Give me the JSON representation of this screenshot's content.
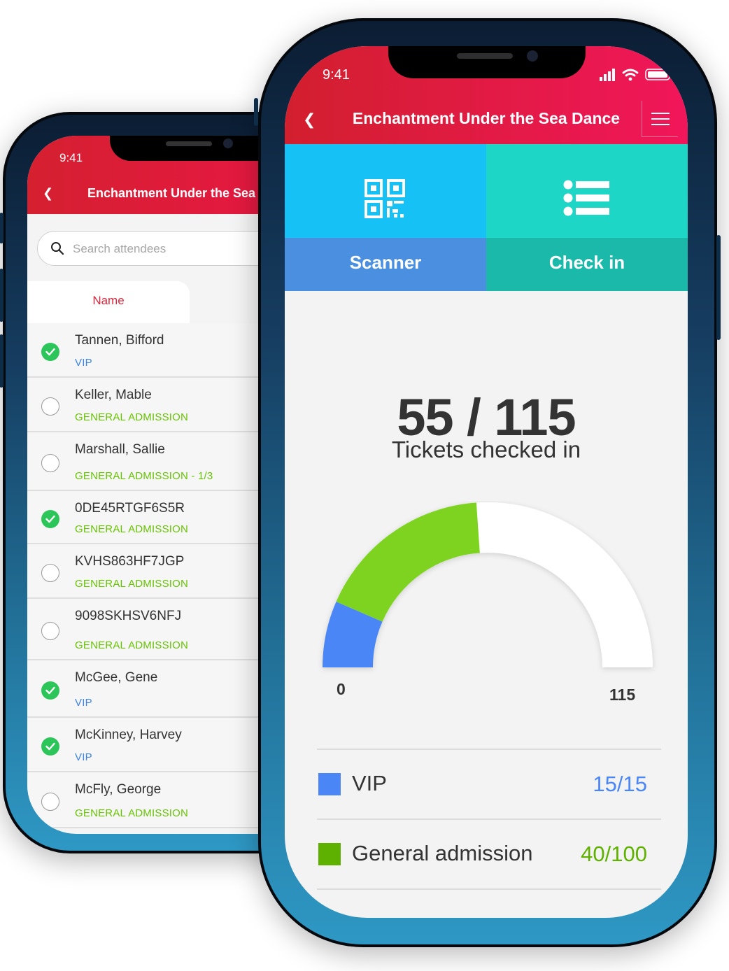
{
  "colors": {
    "header_red": "#d52030",
    "header_pink": "#f1165a",
    "scanner_blue": "#16c2f5",
    "checkin_teal": "#1ed6c5",
    "vip_blue": "#4a86f5",
    "general_green": "#5fb100",
    "check_green": "#2cc559"
  },
  "back_phone": {
    "status_time": "9:41",
    "title": "Enchantment Under the Sea D",
    "search": {
      "placeholder": "Search attendees",
      "icon": "search-icon"
    },
    "tab_name": "Name",
    "attendees": [
      {
        "name": "Tannen, Bifford",
        "type": "VIP",
        "checked": true
      },
      {
        "name": "Keller, Mable",
        "type": "GENERAL ADMISSION",
        "checked": false
      },
      {
        "name": "Marshall, Sallie",
        "type": "GENERAL ADMISSION - 1/3",
        "checked": false
      },
      {
        "name": "0DE45RTGF6S5R",
        "type": "GENERAL ADMISSION",
        "checked": true
      },
      {
        "name": "KVHS863HF7JGP",
        "type": "GENERAL ADMISSION",
        "checked": false
      },
      {
        "name": "9098SKHSV6NFJ",
        "type": "GENERAL ADMISSION",
        "checked": false
      },
      {
        "name": "McGee, Gene",
        "type": "VIP",
        "checked": true
      },
      {
        "name": "McKinney, Harvey",
        "type": "VIP",
        "checked": true
      },
      {
        "name": "McFly, George",
        "type": "GENERAL ADMISSION",
        "checked": false
      }
    ]
  },
  "front_phone": {
    "status_time": "9:41",
    "title": "Enchantment Under the Sea Dance",
    "menu_icon": "hamburger-icon",
    "tiles": {
      "scanner": {
        "label": "Scanner",
        "icon": "qr-code-icon"
      },
      "checkin": {
        "label": "Check in",
        "icon": "list-icon"
      }
    },
    "summary": {
      "count_text": "55 / 115",
      "label": "Tickets checked in"
    },
    "gauge": {
      "min_label": "0",
      "max_label": "115",
      "min": 0,
      "max": 115,
      "segments": [
        {
          "name": "VIP",
          "value": 15,
          "color": "#4a86f5"
        },
        {
          "name": "General admission",
          "value": 40,
          "color": "#7ed321"
        }
      ]
    },
    "legend": [
      {
        "name": "VIP",
        "value": "15/15",
        "color": "#4a86f5"
      },
      {
        "name": "General admission",
        "value": "40/100",
        "color": "#5fb100"
      }
    ]
  }
}
